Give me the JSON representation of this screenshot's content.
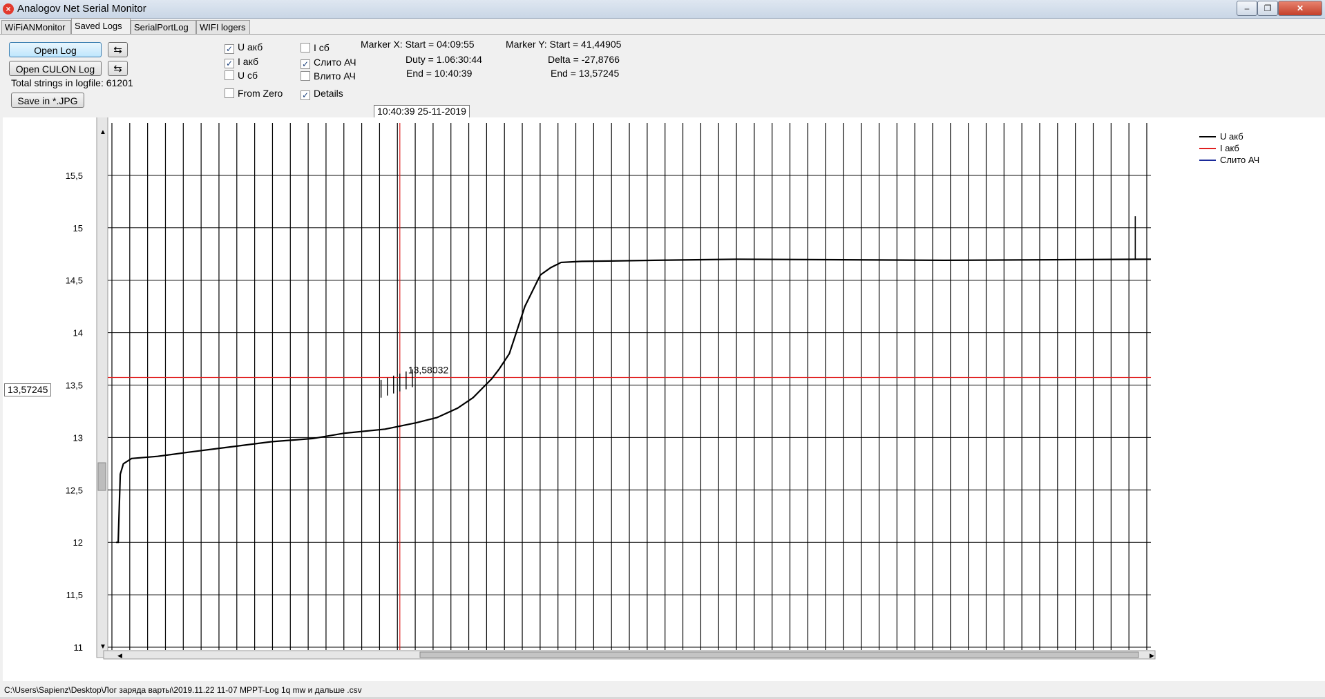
{
  "window": {
    "title": "Analogov Net Serial Monitor",
    "icon": "close-circle-icon",
    "controls": [
      "minimize-icon",
      "maximize-icon",
      "close-icon"
    ]
  },
  "tabs": [
    {
      "label": "WiFiANMonitor"
    },
    {
      "label": "Saved Logs",
      "active": true
    },
    {
      "label": "SerialPortLog"
    },
    {
      "label": "WIFI logers"
    }
  ],
  "toolbar": {
    "open_log": "Open Log",
    "open_culon_log": "Open CULON Log",
    "reload_icon": "refresh-icon",
    "total_strings": "Total strings in logfile: 61201",
    "save_jpg": "Save in *.JPG"
  },
  "checkboxes": [
    {
      "label": "U акб",
      "checked": true
    },
    {
      "label": "I акб",
      "checked": true
    },
    {
      "label": "U сб",
      "checked": false
    },
    {
      "label": "From Zero",
      "checked": false
    },
    {
      "label": "I сб",
      "checked": false
    },
    {
      "label": "Слито АЧ",
      "checked": true
    },
    {
      "label": "Влито АЧ",
      "checked": false
    },
    {
      "label": "Details",
      "checked": true
    }
  ],
  "markers": {
    "x_start": "Marker X: Start = 04:09:55",
    "x_duty": "Duty = 1.06:30:44",
    "x_end": "End  = 10:40:39",
    "y_start": "Marker Y: Start = 41,44905",
    "y_delta": "Delta = -27,8766",
    "y_end": "End  = 13,57245"
  },
  "cursor_time": "10:40:39 25-11-2019",
  "cursor_value": "13,57245",
  "status_path": "C:\\Users\\Sapienz\\Desktop\\Лог заряда варты\\2019.11.22 11-07 MPPT-Log 1q mw и дальше .csv",
  "chart_data": {
    "type": "line",
    "ylim": [
      11,
      16
    ],
    "yticks": [
      "11",
      "11,5",
      "12",
      "12,5",
      "13",
      "13,5",
      "14",
      "14,5",
      "15",
      "15,5"
    ],
    "grid": true,
    "legend_position": "top-right",
    "series": [
      {
        "name": "U акб",
        "color": "#000000",
        "values": [
          [
            0,
            12.0
          ],
          [
            0.002,
            12.0
          ],
          [
            0.004,
            12.65
          ],
          [
            0.007,
            12.75
          ],
          [
            0.015,
            12.8
          ],
          [
            0.04,
            12.82
          ],
          [
            0.07,
            12.86
          ],
          [
            0.11,
            12.91
          ],
          [
            0.15,
            12.96
          ],
          [
            0.19,
            12.99
          ],
          [
            0.22,
            13.04
          ],
          [
            0.26,
            13.08
          ],
          [
            0.29,
            13.14
          ],
          [
            0.31,
            13.19
          ],
          [
            0.33,
            13.28
          ],
          [
            0.345,
            13.38
          ],
          [
            0.355,
            13.48
          ],
          [
            0.363,
            13.56
          ],
          [
            0.37,
            13.65
          ],
          [
            0.38,
            13.8
          ],
          [
            0.395,
            14.25
          ],
          [
            0.41,
            14.55
          ],
          [
            0.42,
            14.62
          ],
          [
            0.43,
            14.67
          ],
          [
            0.45,
            14.68
          ],
          [
            0.52,
            14.69
          ],
          [
            0.6,
            14.7
          ],
          [
            0.8,
            14.69
          ],
          [
            1.0,
            14.7
          ],
          [
            1.0,
            14.7
          ]
        ]
      },
      {
        "name": "I акб",
        "color": "#e02020",
        "values": []
      },
      {
        "name": "Слито АЧ",
        "color": "#1a2a9a",
        "values": []
      }
    ],
    "marker_label": "13,58032",
    "marker_x_fraction": 0.28,
    "marker_y_value": 13.57245
  }
}
